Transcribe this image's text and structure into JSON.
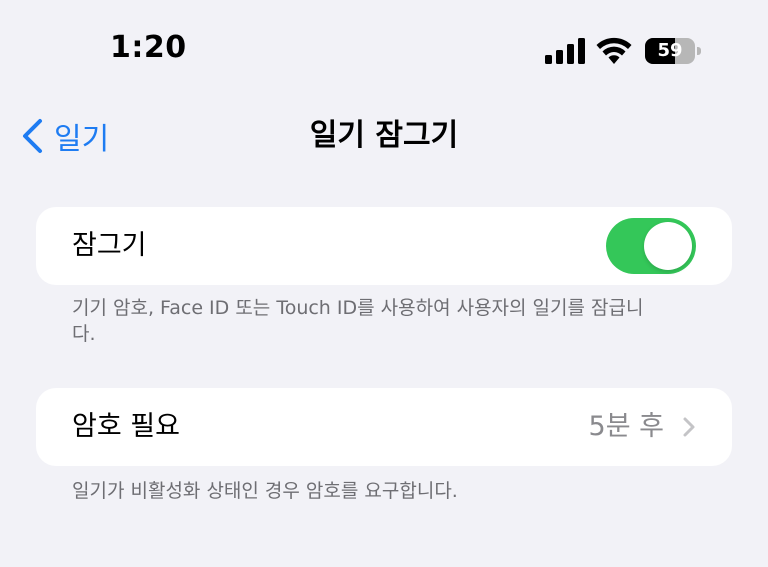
{
  "status_bar": {
    "time": "1:20",
    "battery_level": "59",
    "icons": [
      "signal-icon",
      "wifi-icon",
      "battery-icon"
    ]
  },
  "nav": {
    "back_label": "일기",
    "title": "일기 잠그기"
  },
  "lock_section": {
    "label": "잠그기",
    "toggle_on": true,
    "footnote": "기기 암호, Face ID 또는 Touch ID를 사용하여 사용자의 일기를 잠급니다."
  },
  "password_section": {
    "label": "암호 필요",
    "value": "5분 후",
    "footnote": "일기가 비활성화 상태인 경우 암호를 요구합니다."
  },
  "colors": {
    "accent": "#1e7cf2",
    "toggle_on": "#34c759",
    "background": "#f2f2f7",
    "secondary_text": "#8a8a8e",
    "footnote_text": "#6e6e73"
  }
}
